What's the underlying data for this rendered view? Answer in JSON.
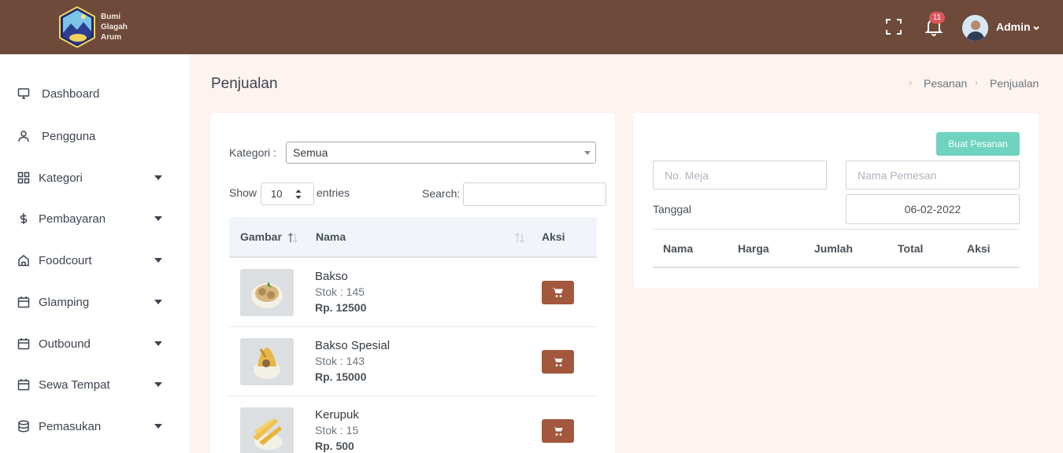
{
  "brand": {
    "line1": "Bumi",
    "line2": "Glagah",
    "line3": "Arum"
  },
  "topbar": {
    "notification_count": "11",
    "user_name": "Admin"
  },
  "sidebar": {
    "items": [
      {
        "label": "Dashboard",
        "icon": "monitor-icon",
        "has_submenu": false
      },
      {
        "label": "Pengguna",
        "icon": "user-icon",
        "has_submenu": false
      },
      {
        "label": "Kategori",
        "icon": "grid-icon",
        "has_submenu": true
      },
      {
        "label": "Pembayaran",
        "icon": "dollar-icon",
        "has_submenu": true
      },
      {
        "label": "Foodcourt",
        "icon": "home-icon",
        "has_submenu": true
      },
      {
        "label": "Glamping",
        "icon": "calendar-icon",
        "has_submenu": true
      },
      {
        "label": "Outbound",
        "icon": "calendar-icon",
        "has_submenu": true
      },
      {
        "label": "Sewa Tempat",
        "icon": "calendar-icon",
        "has_submenu": true
      },
      {
        "label": "Pemasukan",
        "icon": "database-icon",
        "has_submenu": true
      }
    ]
  },
  "header": {
    "title": "Penjualan",
    "breadcrumb": [
      "Pesanan",
      "Penjualan"
    ]
  },
  "products": {
    "kategori_label": "Kategori :",
    "kategori_value": "Semua",
    "show_label": "Show",
    "show_value": "10",
    "entries_label": "entries",
    "search_label": "Search:",
    "columns": [
      "Gambar",
      "Nama",
      "Aksi"
    ],
    "rows": [
      {
        "name": "Bakso",
        "stock": "Stok : 145",
        "price": "Rp. 12500"
      },
      {
        "name": "Bakso Spesial",
        "stock": "Stok : 143",
        "price": "Rp. 15000"
      },
      {
        "name": "Kerupuk",
        "stock": "Stok : 15",
        "price": "Rp. 500"
      }
    ]
  },
  "order": {
    "create_button": "Buat Pesanan",
    "table_no_placeholder": "No. Meja",
    "customer_placeholder": "Nama Pemesan",
    "date_label": "Tanggal",
    "date_value": "06-02-2022",
    "columns": [
      "Nama",
      "Harga",
      "Jumlah",
      "Total",
      "Aksi"
    ]
  },
  "colors": {
    "topbar": "#6e4a3b",
    "accent": "#a3573c",
    "create_button": "#6fd3c0",
    "badge": "#e0555a"
  }
}
